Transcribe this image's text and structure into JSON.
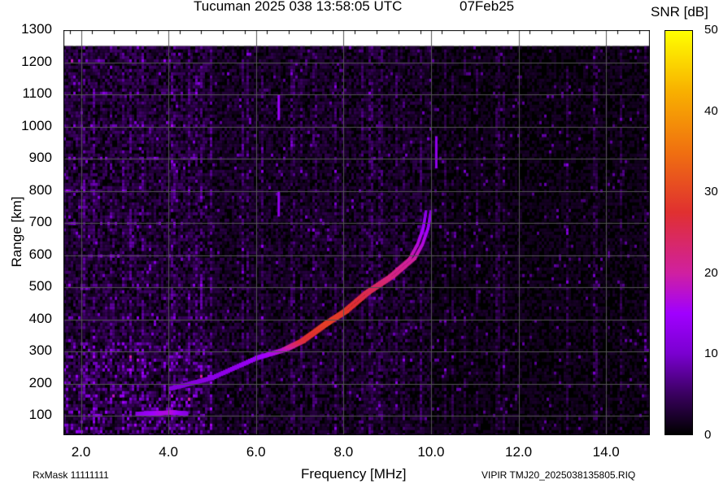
{
  "header": {
    "title": "Tucuman 2025 038 13:58:05 UTC",
    "date": "07Feb25"
  },
  "footer": {
    "rx_mask": "RxMask 11111111",
    "file": "VIPIR  TMJ20_2025038135805.RIQ"
  },
  "colors": {
    "background": "#000000",
    "grid": "#555555",
    "trace_low": "#8000ff",
    "trace_high": "#d03000"
  },
  "chart_data": {
    "type": "heatmap",
    "title": "Tucuman 2025 038 13:58:05 UTC",
    "xlabel": "Frequency [MHz]",
    "ylabel": "Range [km]",
    "xlim": [
      1.6,
      15.0
    ],
    "ylim": [
      40,
      1300
    ],
    "data_top_km": 1250,
    "grid": true,
    "x_ticks": [
      "2.0",
      "4.0",
      "6.0",
      "8.0",
      "10.0",
      "12.0",
      "14.0"
    ],
    "x_tick_values": [
      2,
      4,
      6,
      8,
      10,
      12,
      14
    ],
    "y_ticks": [
      "100",
      "200",
      "300",
      "400",
      "500",
      "600",
      "700",
      "800",
      "900",
      "1000",
      "1100",
      "1200",
      "1300"
    ],
    "y_tick_values": [
      100,
      200,
      300,
      400,
      500,
      600,
      700,
      800,
      900,
      1000,
      1100,
      1200,
      1300
    ],
    "colorbar": {
      "label": "SNR [dB]",
      "range": [
        0,
        50
      ],
      "ticks": [
        "0",
        "10",
        "20",
        "30",
        "40",
        "50"
      ],
      "tick_values": [
        0,
        10,
        20,
        30,
        40,
        50
      ]
    },
    "traces": [
      {
        "name": "F-layer O/X trace",
        "points": [
          {
            "f": 4.05,
            "km": 186,
            "snr": 11
          },
          {
            "f": 4.99,
            "km": 219,
            "snr": 12
          },
          {
            "f": 6.03,
            "km": 282,
            "snr": 14
          },
          {
            "f": 6.66,
            "km": 307,
            "snr": 18
          },
          {
            "f": 7.04,
            "km": 332,
            "snr": 26
          },
          {
            "f": 7.6,
            "km": 387,
            "snr": 29
          },
          {
            "f": 8.03,
            "km": 425,
            "snr": 28
          },
          {
            "f": 8.53,
            "km": 483,
            "snr": 25
          },
          {
            "f": 9.09,
            "km": 534,
            "snr": 22
          },
          {
            "f": 9.56,
            "km": 589,
            "snr": 20
          },
          {
            "f": 9.74,
            "km": 634,
            "snr": 17
          },
          {
            "f": 9.87,
            "km": 685,
            "snr": 15
          },
          {
            "f": 9.93,
            "km": 735,
            "snr": 12
          }
        ]
      },
      {
        "name": "E-layer trace",
        "points": [
          {
            "f": 3.3,
            "km": 108,
            "snr": 12
          },
          {
            "f": 3.8,
            "km": 110,
            "snr": 16
          },
          {
            "f": 4.1,
            "km": 112,
            "snr": 17
          },
          {
            "f": 4.4,
            "km": 109,
            "snr": 12
          }
        ]
      }
    ],
    "spurious": [
      {
        "f": 6.52,
        "km_from": 1020,
        "km_to": 1100,
        "snr": 14
      },
      {
        "f": 6.52,
        "km_from": 720,
        "km_to": 800,
        "snr": 13
      },
      {
        "f": 10.12,
        "km_from": 870,
        "km_to": 970,
        "snr": 13
      }
    ]
  }
}
